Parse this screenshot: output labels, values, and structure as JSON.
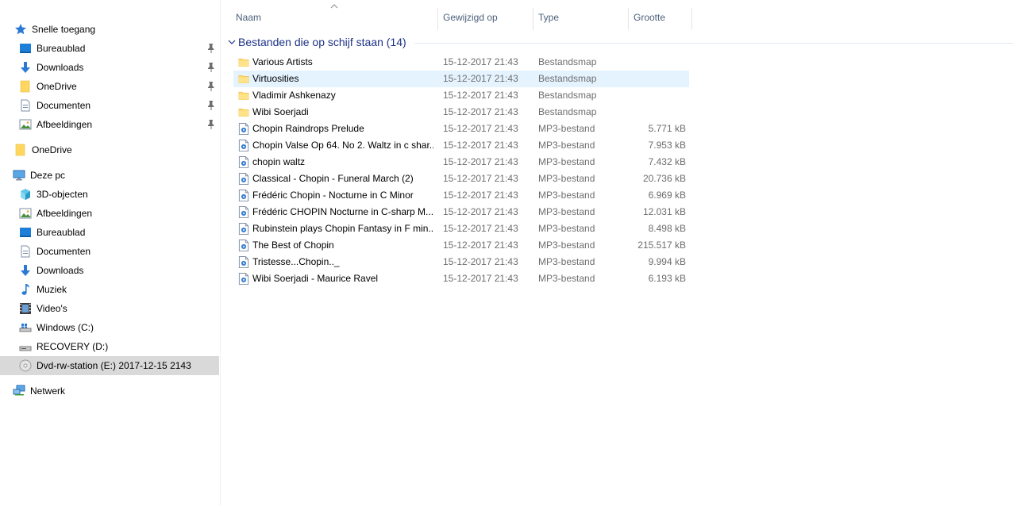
{
  "nav": {
    "quick_access": "Snelle toegang",
    "quick_items": [
      {
        "label": "Bureaublad",
        "icon": "desktop-icon"
      },
      {
        "label": "Downloads",
        "icon": "download-icon"
      },
      {
        "label": "OneDrive",
        "icon": "folder-icon"
      },
      {
        "label": "Documenten",
        "icon": "document-icon"
      },
      {
        "label": "Afbeeldingen",
        "icon": "pictures-icon"
      }
    ],
    "onedrive": "OneDrive",
    "this_pc": "Deze pc",
    "pc_items": [
      {
        "label": "3D-objecten",
        "icon": "3d-objects-icon"
      },
      {
        "label": "Afbeeldingen",
        "icon": "pictures-icon"
      },
      {
        "label": "Bureaublad",
        "icon": "desktop-icon"
      },
      {
        "label": "Documenten",
        "icon": "document-icon"
      },
      {
        "label": "Downloads",
        "icon": "download-icon"
      },
      {
        "label": "Muziek",
        "icon": "music-icon"
      },
      {
        "label": "Video's",
        "icon": "video-icon"
      },
      {
        "label": "Windows (C:)",
        "icon": "drive-icon"
      },
      {
        "label": "RECOVERY (D:)",
        "icon": "drive-icon"
      },
      {
        "label": "Dvd-rw-station (E:) 2017-12-15 2143",
        "icon": "dvd-icon"
      }
    ],
    "network": "Netwerk"
  },
  "columns": {
    "name": "Naam",
    "modified": "Gewijzigd op",
    "type": "Type",
    "size": "Grootte"
  },
  "group": {
    "title": "Bestanden die op schijf staan (14)"
  },
  "files": [
    {
      "name": "Various Artists",
      "date": "15-12-2017 21:43",
      "type": "Bestandsmap",
      "size": "",
      "kind": "folder"
    },
    {
      "name": "Virtuosities",
      "date": "15-12-2017 21:43",
      "type": "Bestandsmap",
      "size": "",
      "kind": "folder"
    },
    {
      "name": "Vladimir Ashkenazy",
      "date": "15-12-2017 21:43",
      "type": "Bestandsmap",
      "size": "",
      "kind": "folder"
    },
    {
      "name": "Wibi Soerjadi",
      "date": "15-12-2017 21:43",
      "type": "Bestandsmap",
      "size": "",
      "kind": "folder"
    },
    {
      "name": "Chopin Raindrops Prelude",
      "date": "15-12-2017 21:43",
      "type": "MP3-bestand",
      "size": "5.771 kB",
      "kind": "mp3"
    },
    {
      "name": "Chopin Valse Op 64. No 2. Waltz in c shar...",
      "date": "15-12-2017 21:43",
      "type": "MP3-bestand",
      "size": "7.953 kB",
      "kind": "mp3"
    },
    {
      "name": "chopin waltz",
      "date": "15-12-2017 21:43",
      "type": "MP3-bestand",
      "size": "7.432 kB",
      "kind": "mp3"
    },
    {
      "name": "Classical - Chopin - Funeral March (2)",
      "date": "15-12-2017 21:43",
      "type": "MP3-bestand",
      "size": "20.736 kB",
      "kind": "mp3"
    },
    {
      "name": "Frédéric Chopin - Nocturne in C Minor",
      "date": "15-12-2017 21:43",
      "type": "MP3-bestand",
      "size": "6.969 kB",
      "kind": "mp3"
    },
    {
      "name": "Frédéric CHOPIN Nocturne in C-sharp M...",
      "date": "15-12-2017 21:43",
      "type": "MP3-bestand",
      "size": "12.031 kB",
      "kind": "mp3"
    },
    {
      "name": "Rubinstein plays Chopin Fantasy in F min...",
      "date": "15-12-2017 21:43",
      "type": "MP3-bestand",
      "size": "8.498 kB",
      "kind": "mp3"
    },
    {
      "name": "The Best of Chopin",
      "date": "15-12-2017 21:43",
      "type": "MP3-bestand",
      "size": "215.517 kB",
      "kind": "mp3"
    },
    {
      "name": "Tristesse...Chopin.._",
      "date": "15-12-2017 21:43",
      "type": "MP3-bestand",
      "size": "9.994 kB",
      "kind": "mp3"
    },
    {
      "name": "Wibi Soerjadi - Maurice Ravel",
      "date": "15-12-2017 21:43",
      "type": "MP3-bestand",
      "size": "6.193 kB",
      "kind": "mp3"
    }
  ],
  "colors": {
    "folder": "#ffd75e",
    "selection": "#d9d9d9",
    "hover": "#e5f3ff",
    "group_title": "#1e3287",
    "column_header": "#4c607a"
  }
}
